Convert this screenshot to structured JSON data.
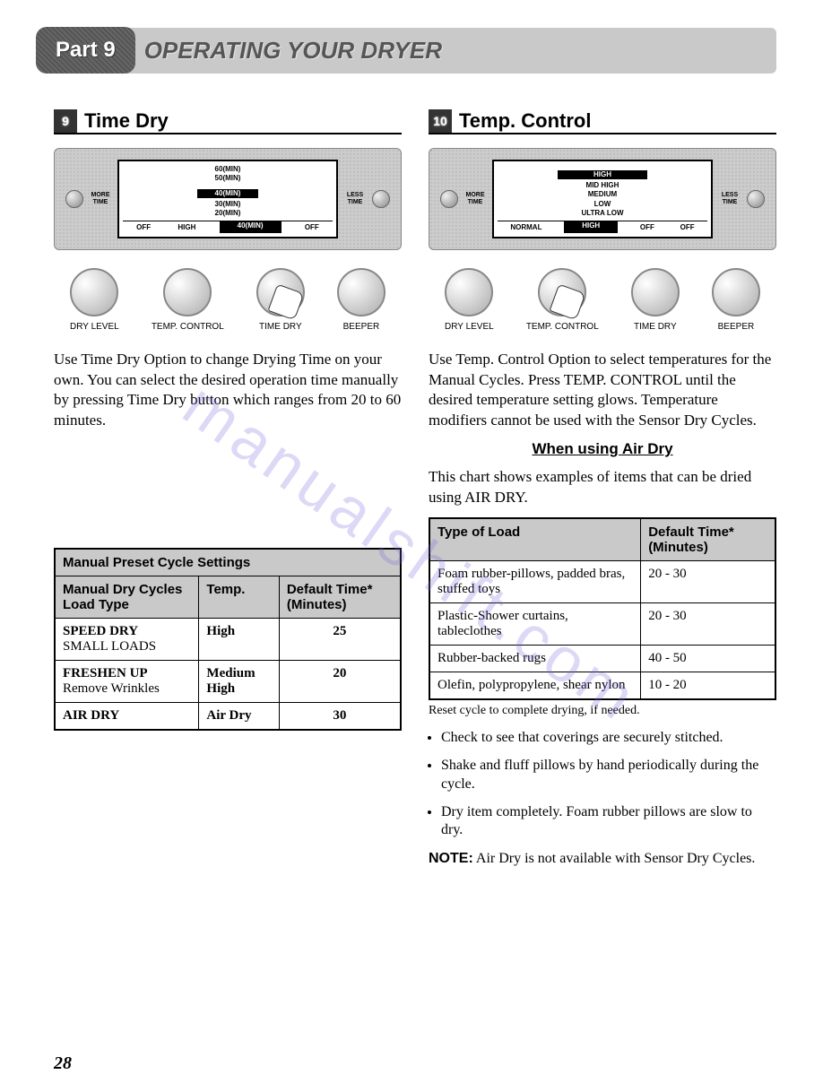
{
  "header": {
    "part_label": "Part 9",
    "title": "OPERATING YOUR DRYER"
  },
  "left": {
    "num": "9",
    "title": "Time Dry",
    "panel": {
      "more": "MORE TIME",
      "less": "LESS TIME",
      "list": [
        "60(MIN)",
        "50(MIN)",
        "40(MIN)",
        "30(MIN)",
        "20(MIN)"
      ],
      "selected_index": 2,
      "bottom": [
        "OFF",
        "HIGH",
        "40(MIN)",
        "OFF"
      ],
      "bottom_selected": 2
    },
    "knobs": [
      "DRY LEVEL",
      "TEMP. CONTROL",
      "TIME DRY",
      "BEEPER"
    ],
    "hand_knob": 2,
    "paragraph": "Use Time Dry Option to change Drying Time on your own. You can select the desired operation time manually by pressing Time Dry button which ranges from 20 to 60 minutes.",
    "table": {
      "title": "Manual Preset Cycle Settings",
      "headers": [
        "Manual Dry Cycles Load Type",
        "Temp.",
        "Default Time* (Minutes)"
      ],
      "rows": [
        {
          "c1a": "SPEED DRY",
          "c1b": "SMALL LOADS",
          "c2": "High",
          "c3": "25"
        },
        {
          "c1a": "FRESHEN UP",
          "c1b": "Remove Wrinkles",
          "c2": "Medium High",
          "c3": "20"
        },
        {
          "c1a": "AIR DRY",
          "c1b": "",
          "c2": "Air Dry",
          "c3": "30"
        }
      ]
    }
  },
  "right": {
    "num": "10",
    "title": "Temp. Control",
    "panel": {
      "more": "MORE TIME",
      "less": "LESS TIME",
      "list": [
        "HIGH",
        "MID HIGH",
        "MEDIUM",
        "LOW",
        "ULTRA LOW"
      ],
      "selected_index": 0,
      "bottom": [
        "NORMAL",
        "HIGH",
        "OFF",
        "OFF"
      ],
      "bottom_selected": 1
    },
    "knobs": [
      "DRY LEVEL",
      "TEMP. CONTROL",
      "TIME DRY",
      "BEEPER"
    ],
    "hand_knob": 1,
    "paragraph": "Use Temp. Control Option to select temperatures for the Manual Cycles. Press TEMP. CONTROL until the desired temperature setting glows. Temperature modifiers cannot be used with the Sensor Dry Cycles.",
    "sub_heading": "When using Air Dry",
    "sub_paragraph": "This chart shows examples of items that can be dried using AIR DRY.",
    "table": {
      "headers": [
        "Type of Load",
        "Default Time* (Minutes)"
      ],
      "rows": [
        {
          "c1": "Foam rubber-pillows, padded bras, stuffed toys",
          "c2": "20 - 30"
        },
        {
          "c1": "Plastic-Shower curtains, tableclothes",
          "c2": "20 - 30"
        },
        {
          "c1": "Rubber-backed rugs",
          "c2": "40 - 50"
        },
        {
          "c1": "Olefin, polypropylene, shear nylon",
          "c2": "10 - 20"
        }
      ]
    },
    "footnote": "Reset cycle to complete drying, if needed.",
    "tips": [
      "Check to see that coverings are securely stitched.",
      "Shake and fluff pillows by hand periodically during the cycle.",
      "Dry item completely. Foam rubber pillows are slow to dry."
    ],
    "note_label": "NOTE:",
    "note_text": "Air Dry is not available with Sensor Dry Cycles."
  },
  "page_number": "28",
  "watermark": "manualshift.com"
}
